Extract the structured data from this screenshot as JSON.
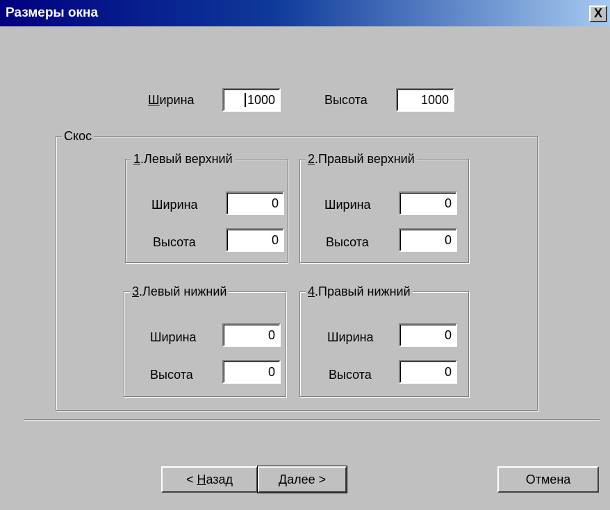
{
  "window": {
    "title": "Размеры окна",
    "close_glyph": "X"
  },
  "main": {
    "width": {
      "label_mnemonic": "Ш",
      "label_rest": "ирина",
      "value": "1000"
    },
    "height": {
      "label": "Высота",
      "value": "1000"
    }
  },
  "bevel": {
    "title": "Скос",
    "groups": [
      {
        "num": "1",
        "rest": ".Левый верхний",
        "width_label": "Ширина",
        "width_value": "0",
        "height_label": "Высота",
        "height_value": "0"
      },
      {
        "num": "2",
        "rest": ".Правый верхний",
        "width_label": "Ширина",
        "width_value": "0",
        "height_label": "Высота",
        "height_value": "0"
      },
      {
        "num": "3",
        "rest": ".Левый нижний",
        "width_label": "Ширина",
        "width_value": "0",
        "height_label": "Высота",
        "height_value": "0"
      },
      {
        "num": "4",
        "rest": ".Правый нижний",
        "width_label": "Ширина",
        "width_value": "0",
        "height_label": "Высота",
        "height_value": "0"
      }
    ]
  },
  "buttons": {
    "back_prefix": "< ",
    "back_mnemonic": "Н",
    "back_rest": "азад",
    "next": "Далее >",
    "cancel": "Отмена"
  }
}
